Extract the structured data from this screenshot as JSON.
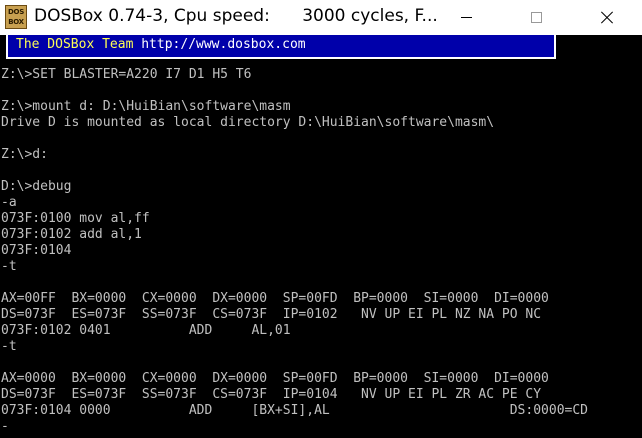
{
  "window": {
    "title": "DOSBox 0.74-3, Cpu speed:      3000 cycles, F...",
    "icon_text": [
      "DOS",
      "BOX"
    ]
  },
  "banner": {
    "team": "The DOSBox Team ",
    "url": "http://www.dosbox.com"
  },
  "terminal": {
    "lines": [
      "Z:\\>SET BLASTER=A220 I7 D1 H5 T6",
      "",
      "Z:\\>mount d: D:\\HuiBian\\software\\masm",
      "Drive D is mounted as local directory D:\\HuiBian\\software\\masm\\",
      "",
      "Z:\\>d:",
      "",
      "D:\\>debug",
      "-a",
      "073F:0100 mov al,ff",
      "073F:0102 add al,1",
      "073F:0104",
      "-t",
      "",
      "AX=00FF  BX=0000  CX=0000  DX=0000  SP=00FD  BP=0000  SI=0000  DI=0000",
      "DS=073F  ES=073F  SS=073F  CS=073F  IP=0102   NV UP EI PL NZ NA PO NC",
      "073F:0102 0401          ADD     AL,01",
      "-t",
      "",
      "AX=0000  BX=0000  CX=0000  DX=0000  SP=00FD  BP=0000  SI=0000  DI=0000",
      "DS=073F  ES=073F  SS=073F  CS=073F  IP=0104   NV UP EI PL ZR AC PE CY",
      "073F:0104 0000          ADD     [BX+SI],AL                       DS:0000=CD",
      "-"
    ]
  },
  "colors": {
    "terminal_bg": "#000000",
    "terminal_fg": "#c0c0c0",
    "banner_bg": "#0000aa",
    "banner_team": "#ffff55",
    "banner_url": "#ffffff"
  }
}
